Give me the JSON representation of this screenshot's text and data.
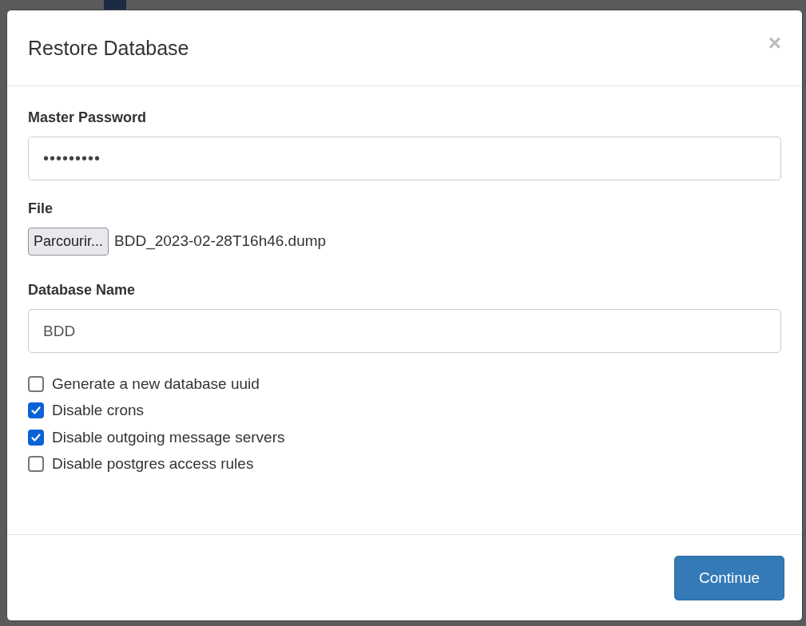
{
  "dialog": {
    "title": "Restore Database",
    "close": "×"
  },
  "master_password": {
    "label": "Master Password",
    "value": "•••••••••"
  },
  "file": {
    "label": "File",
    "button": "Parcourir...",
    "filename": "BDD_2023-02-28T16h46.dump"
  },
  "database_name": {
    "label": "Database Name",
    "value": "BDD"
  },
  "options": [
    {
      "label": "Generate a new database uuid",
      "checked": false
    },
    {
      "label": "Disable crons",
      "checked": true
    },
    {
      "label": "Disable outgoing message servers",
      "checked": true
    },
    {
      "label": "Disable postgres access rules",
      "checked": false
    }
  ],
  "buttons": [
    {
      "label": "Continue"
    }
  ]
}
